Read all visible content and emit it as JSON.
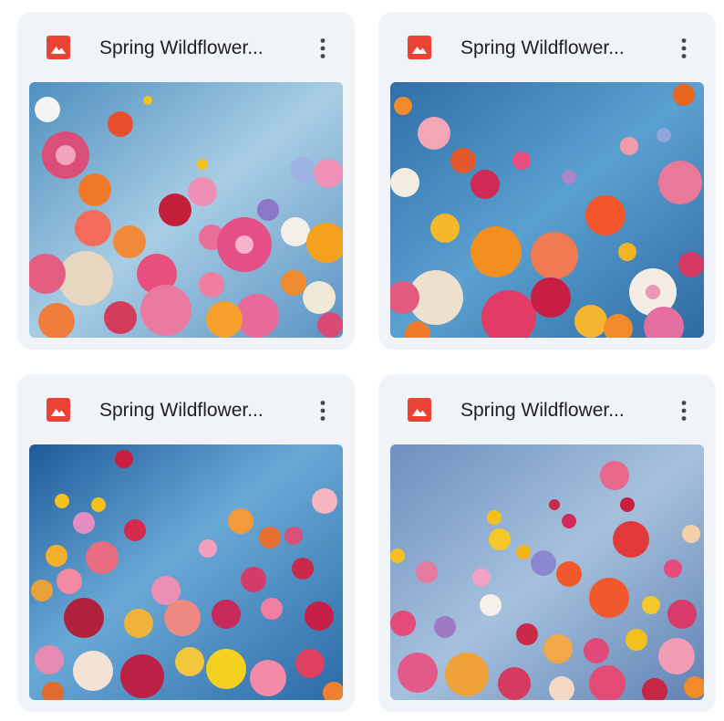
{
  "files": [
    {
      "title": "Spring Wildflower...",
      "icon": "image-file-icon",
      "menu_icon": "more-vert-icon",
      "background": "#7fb3d5"
    },
    {
      "title": "Spring Wildflower...",
      "icon": "image-file-icon",
      "menu_icon": "more-vert-icon",
      "background": "#4e90c6"
    },
    {
      "title": "Spring Wildflower...",
      "icon": "image-file-icon",
      "menu_icon": "more-vert-icon",
      "background": "#3f7fb8"
    },
    {
      "title": "Spring Wildflower...",
      "icon": "image-file-icon",
      "menu_icon": "more-vert-icon",
      "background": "#86a9cf"
    }
  ],
  "colors": {
    "card_bg": "#f0f3f8",
    "icon_red": "#ea4335",
    "title_text": "#1f1f1f",
    "menu_dots": "#444746"
  }
}
